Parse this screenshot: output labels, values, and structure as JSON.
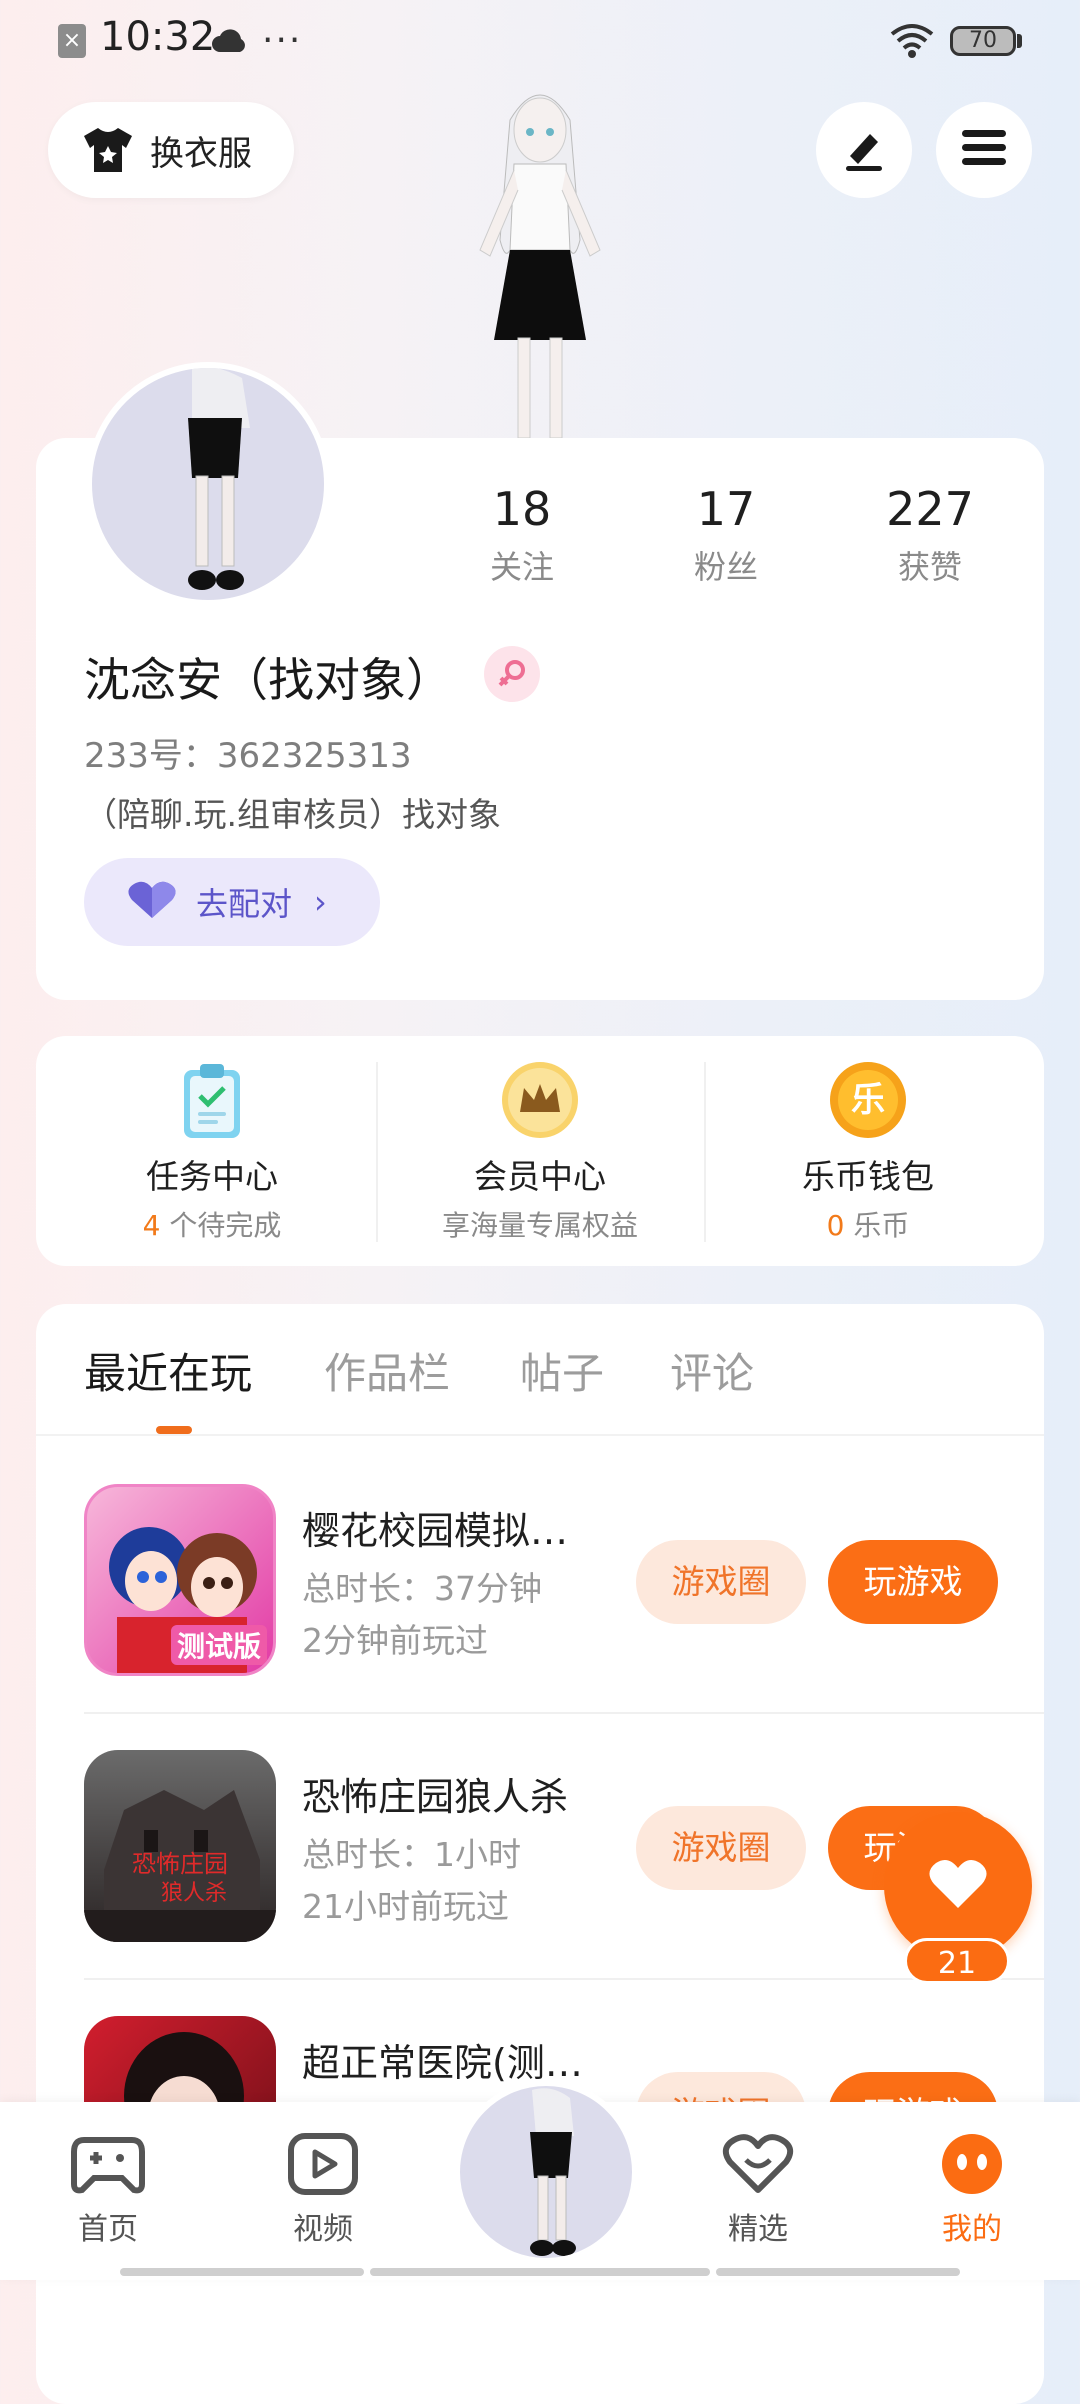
{
  "status_bar": {
    "time": "10:32",
    "sim_glyph": "×",
    "dots": "···",
    "battery": "70"
  },
  "top_buttons": {
    "outfit_label": "换衣服"
  },
  "profile": {
    "stats": [
      {
        "value": "18",
        "label": "关注"
      },
      {
        "value": "17",
        "label": "粉丝"
      },
      {
        "value": "227",
        "label": "获赞"
      }
    ],
    "username": "沈念安（找对象）",
    "user_id": "233号：362325313",
    "bio": "（陪聊.玩.组审核员）找对象",
    "match_label": "去配对",
    "match_chevron": "›"
  },
  "services": {
    "items": [
      {
        "title": "任务中心",
        "highlight": "4",
        "sub": " 个待完成",
        "icon": "clipboard-icon"
      },
      {
        "title": "会员中心",
        "highlight": "",
        "sub": "享海量专属权益",
        "icon": "crown-icon"
      },
      {
        "title": "乐币钱包",
        "highlight": "0",
        "sub": " 乐币",
        "icon": "coin-icon",
        "coin_glyph": "乐"
      }
    ]
  },
  "tabs": [
    {
      "label": "最近在玩"
    },
    {
      "label": "作品栏"
    },
    {
      "label": "帖子"
    },
    {
      "label": "评论"
    }
  ],
  "games": [
    {
      "title": "樱花校园模拟…",
      "duration": "总时长：37分钟",
      "last_played": "2分钟前玩过",
      "circle_label": "游戏圈",
      "play_label": "玩游戏",
      "icon_badge": "测试版"
    },
    {
      "title": "恐怖庄园狼人杀",
      "duration": "总时长：1小时",
      "last_played": "21小时前玩过",
      "circle_label": "游戏圈",
      "play_label": "玩游戏"
    },
    {
      "title": "超正常医院(测…",
      "duration": "",
      "last_played": "",
      "circle_label": "游戏圈",
      "play_label": "玩游戏"
    }
  ],
  "like": {
    "count": "21"
  },
  "bottom_nav": [
    {
      "label": "首页"
    },
    {
      "label": "视频"
    },
    {
      "label": "精选"
    },
    {
      "label": "我的"
    }
  ],
  "colors": {
    "accent": "#fb6c12",
    "match_purple": "#5c55c9"
  }
}
